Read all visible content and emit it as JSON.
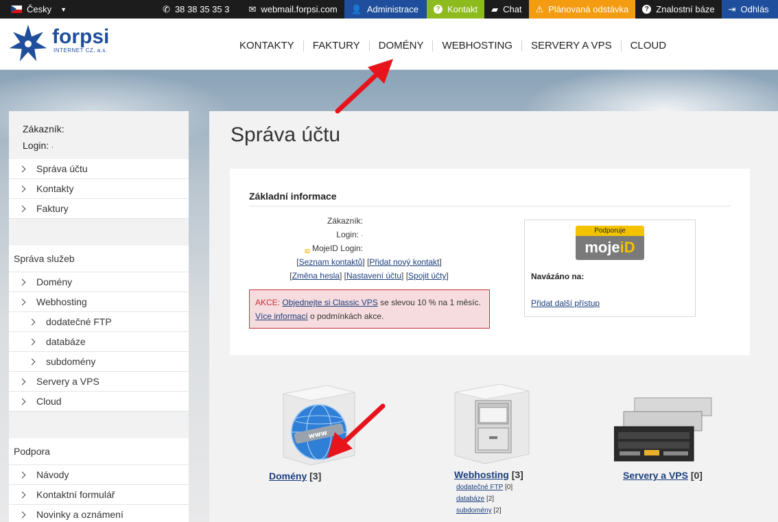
{
  "topbar": {
    "language": "Česky",
    "phone": "38 38 35 35 3",
    "webmail": "webmail.forpsi.com",
    "administrace": "Administrace",
    "kontakt": "Kontakt",
    "chat": "Chat",
    "planned": "Plánovaná odstávka",
    "kb": "Znalostní báze",
    "logout": "Odhlás"
  },
  "logo": {
    "word": "forpsi",
    "sub": "INTERNET CZ, a.s."
  },
  "nav": [
    "KONTAKTY",
    "FAKTURY",
    "DOMÉNY",
    "WEBHOSTING",
    "SERVERY A VPS",
    "CLOUD"
  ],
  "user": {
    "customer_label": "Zákazník:",
    "login_label": "Login:",
    "login_value": "·"
  },
  "sidebar": {
    "account": [
      "Správa účtu",
      "Kontakty",
      "Faktury"
    ],
    "services_title": "Správa služeb",
    "services": [
      {
        "label": "Domény",
        "sub": false
      },
      {
        "label": "Webhosting",
        "sub": false
      },
      {
        "label": "dodatečné FTP",
        "sub": true
      },
      {
        "label": "databáze",
        "sub": true
      },
      {
        "label": "subdomény",
        "sub": true
      },
      {
        "label": "Servery a VPS",
        "sub": false
      },
      {
        "label": "Cloud",
        "sub": false
      }
    ],
    "support_title": "Podpora",
    "support": [
      "Návody",
      "Kontaktní formulář",
      "Novinky a oznámení"
    ]
  },
  "main": {
    "title": "Správa účtu",
    "info_head": "Základní informace",
    "customer": "Zákazník:",
    "login": "Login:",
    "login_value": "·",
    "mojeid_login": "MojeID Login:",
    "links1": [
      "Seznam kontaktů",
      "Přidat nový kontakt"
    ],
    "links2": [
      "Změna hesla",
      "Nastavení účtu",
      "Spojit účty"
    ],
    "promo": {
      "akce": "AKCE:",
      "link1": "Objednejte si Classic VPS",
      "text1": " se slevou 10 % na 1 měsíc.",
      "link2": "Více informací",
      "text2": " o podmínkách akce."
    },
    "mojeid": {
      "badge_top": "Podporuje",
      "badge_main": "moje",
      "badge_id": "iD",
      "navazano": "Navázáno na:",
      "add": "Přidat další přístup"
    }
  },
  "services": {
    "domains": {
      "label": "Domény",
      "count": "[3]"
    },
    "webhosting": {
      "label": "Webhosting",
      "count": "[3]",
      "sub": [
        {
          "label": "dodatečné FTP",
          "count": "[0]"
        },
        {
          "label": "databáze",
          "count": "[2]"
        },
        {
          "label": "subdomény",
          "count": "[2]"
        }
      ]
    },
    "servers": {
      "label": "Servery a VPS",
      "count": "[0]"
    }
  },
  "colors": {
    "brand": "#1f4f9c",
    "topbar": "#1c1c1c",
    "green": "#8dbb1e",
    "orange": "#f39c12",
    "arrow": "#e8141b"
  }
}
